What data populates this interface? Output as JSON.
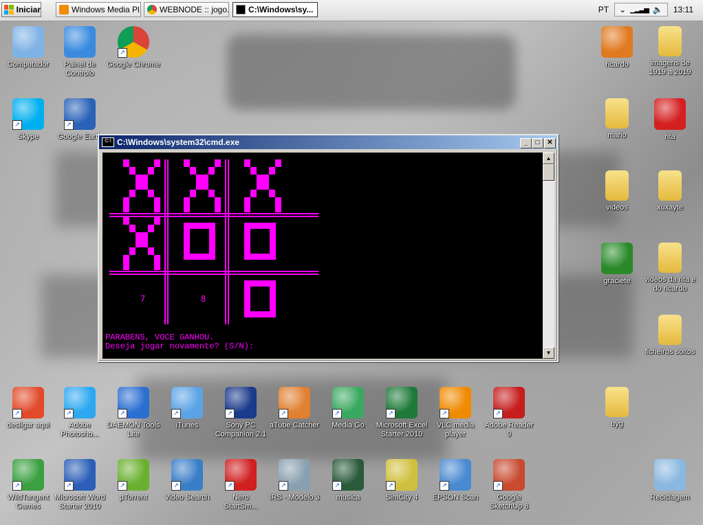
{
  "taskbar": {
    "start_label": "Iniciar",
    "buttons": [
      {
        "label": "Windows Media Pl..."
      },
      {
        "label": "WEBNODE :: jogo..."
      },
      {
        "label": "C:\\Windows\\sy..."
      }
    ],
    "lang": "PT",
    "clock": "13:11"
  },
  "desktop_icons": [
    {
      "label": "Computador"
    },
    {
      "label": "Painel de\nControlo"
    },
    {
      "label": "Google Chrome"
    },
    {
      "label": "Skype"
    },
    {
      "label": "Google Earth"
    },
    {
      "label": "desligar aqui"
    },
    {
      "label": "Adobe\nPhotosho..."
    },
    {
      "label": "DAEMON Tools\nLite"
    },
    {
      "label": "iTunes"
    },
    {
      "label": "Sony PC\nCompanion 2.1"
    },
    {
      "label": "aTube Catcher"
    },
    {
      "label": "Media Go"
    },
    {
      "label": "Microsoft Excel\nStarter 2010"
    },
    {
      "label": "VLC media\nplayer"
    },
    {
      "label": "Adobe Reader\n9"
    },
    {
      "label": "WildTangent\nGames"
    },
    {
      "label": "Microsoft Word\nStarter 2010"
    },
    {
      "label": "µTorrent"
    },
    {
      "label": "Video Search"
    },
    {
      "label": "Nero\nStartSm..."
    },
    {
      "label": "IRS - Modelo 3"
    },
    {
      "label": "musica"
    },
    {
      "label": "SimCity 4"
    },
    {
      "label": "EPSON Scan"
    },
    {
      "label": "Google\nSketchUp 8"
    },
    {
      "label": "ricardo"
    },
    {
      "label": "imagens de\n1919 a 2019"
    },
    {
      "label": "mario"
    },
    {
      "label": "rita"
    },
    {
      "label": "videos"
    },
    {
      "label": "xuxayte"
    },
    {
      "label": "graciete"
    },
    {
      "label": "videos da rita e\ndo ricardo"
    },
    {
      "label": "ficheiros soltos"
    },
    {
      "label": "uyg"
    },
    {
      "label": "Reciclagem"
    }
  ],
  "cmd": {
    "title": "C:\\Windows\\system32\\cmd.exe",
    "board": [
      "X",
      "X",
      "X",
      "X",
      "O",
      "O",
      "7",
      "8",
      "O"
    ],
    "line1": "PARABENS, VOCE GANHOU.",
    "line2": "Deseja jogar novamente? (S/N):",
    "color": "#ff00ff"
  }
}
